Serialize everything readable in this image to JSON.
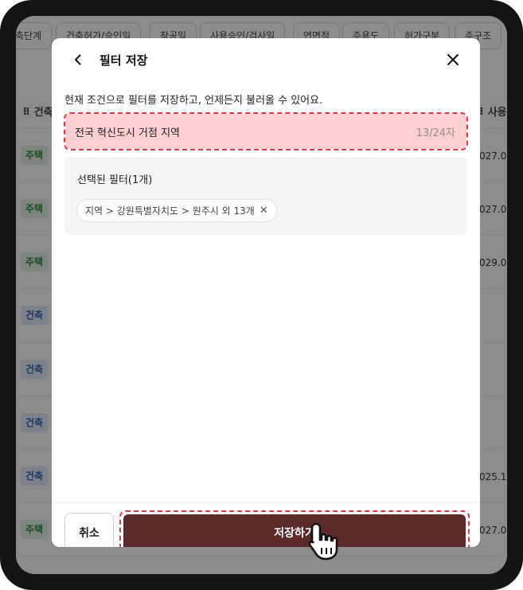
{
  "background": {
    "filter_chips": [
      "축단계",
      "건축허가/승인일",
      "착공일",
      "사용승인/검사일",
      "연면적",
      "주용도",
      "허가구분",
      "주구조"
    ],
    "column_left": "건축",
    "column_right": "사용",
    "row_tags": [
      "주택",
      "주택",
      "주택",
      "건축",
      "건축",
      "건축",
      "건축",
      "주택"
    ],
    "row_dates": [
      "027.0",
      "027.0",
      "029.0",
      "",
      "",
      "",
      "025.1",
      "027.0"
    ]
  },
  "modal": {
    "title": "필터 저장",
    "description": "현재 조건으로 필터를 저장하고, 언제든지 불러올 수 있어요.",
    "name_input": {
      "value": "전국 혁신도시 거점 지역",
      "char_count": "13/24자"
    },
    "selected_filters": {
      "title": "선택된 필터(1개)",
      "chips": [
        "지역 > 강원특별자치도 > 원주시 외 13개"
      ]
    },
    "footer": {
      "cancel_label": "취소",
      "save_label": "저장하기"
    }
  },
  "colors": {
    "accent_highlight": "#e03a44",
    "save_button": "#5c2a2a",
    "input_fill": "#fccfd0"
  },
  "icons": [
    "back-arrow-icon",
    "close-icon",
    "chip-remove-icon",
    "hand-pointer-icon"
  ]
}
